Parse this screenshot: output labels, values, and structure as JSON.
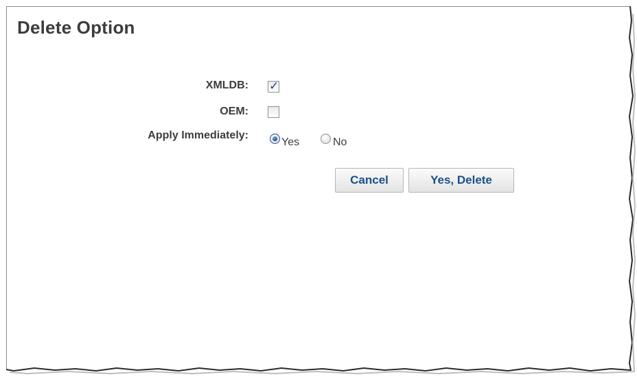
{
  "dialog": {
    "title": "Delete Option"
  },
  "form": {
    "xmldb": {
      "label": "XMLDB:",
      "checked": true
    },
    "oem": {
      "label": "OEM:",
      "checked": false
    },
    "apply_immediately": {
      "label": "Apply Immediately:",
      "options": [
        {
          "label": "Yes",
          "selected": true
        },
        {
          "label": "No",
          "selected": false
        }
      ]
    }
  },
  "buttons": {
    "cancel_label": "Cancel",
    "delete_label": "Yes, Delete"
  },
  "colors": {
    "title_text": "#3c3c3c",
    "button_text": "#1b4f8a",
    "check_mark": "#2a3f8f"
  },
  "icons": {
    "checkmark": "check-icon"
  }
}
